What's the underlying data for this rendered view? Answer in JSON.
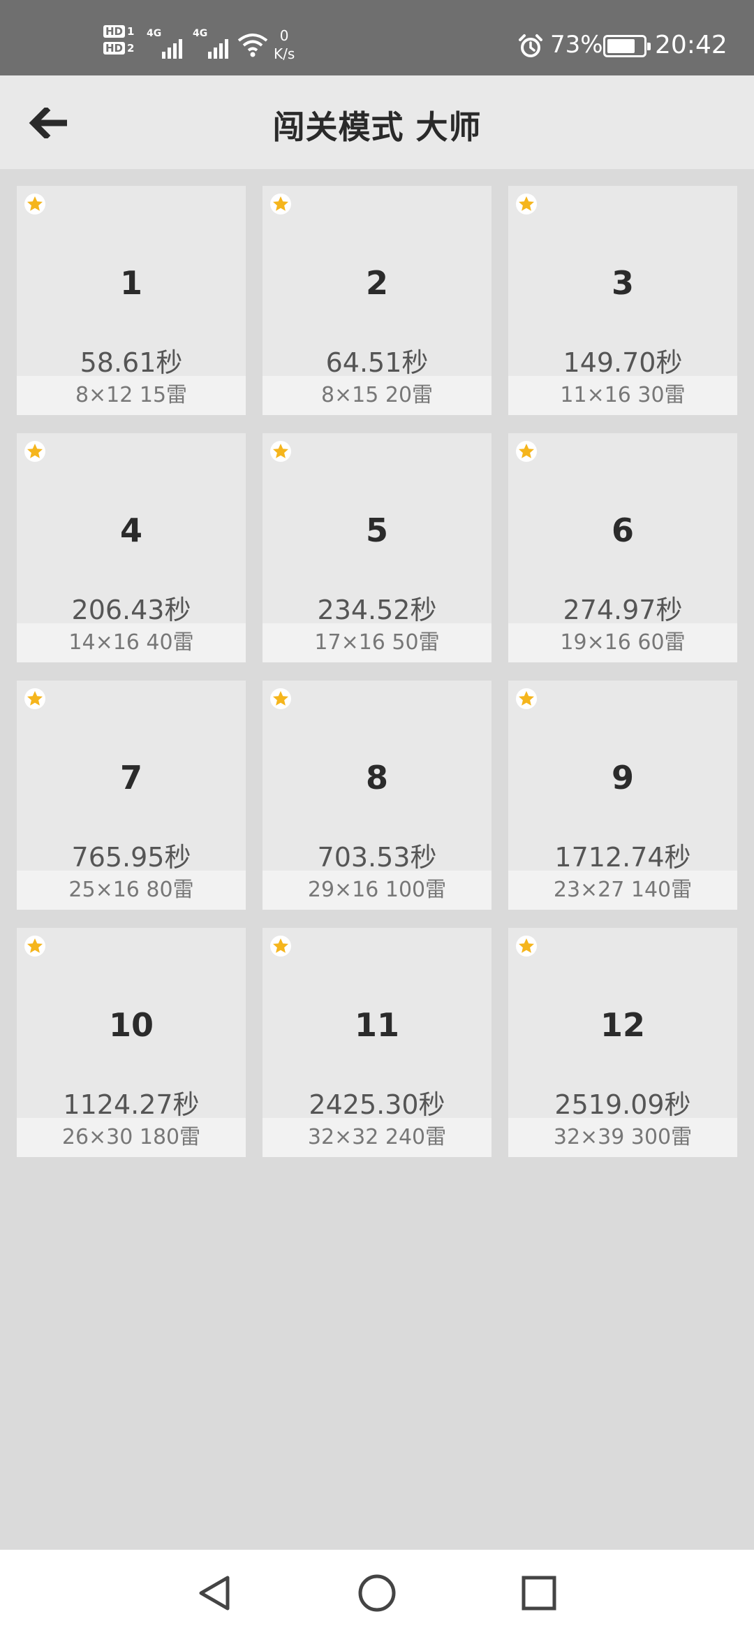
{
  "status_bar": {
    "hd1": "HD",
    "hd1_sim": "1",
    "hd2": "HD",
    "hd2_sim": "2",
    "net1": "4G",
    "net2": "4G",
    "speed_value": "0",
    "speed_unit": "K/s",
    "battery": "73%",
    "time": "20:42"
  },
  "header": {
    "title": "闯关模式 大师",
    "back_icon": "arrow-left-icon"
  },
  "levels": [
    {
      "number": "1",
      "time": "58.61秒",
      "info": "8×12  15雷"
    },
    {
      "number": "2",
      "time": "64.51秒",
      "info": "8×15  20雷"
    },
    {
      "number": "3",
      "time": "149.70秒",
      "info": "11×16  30雷"
    },
    {
      "number": "4",
      "time": "206.43秒",
      "info": "14×16  40雷"
    },
    {
      "number": "5",
      "time": "234.52秒",
      "info": "17×16  50雷"
    },
    {
      "number": "6",
      "time": "274.97秒",
      "info": "19×16  60雷"
    },
    {
      "number": "7",
      "time": "765.95秒",
      "info": "25×16  80雷"
    },
    {
      "number": "8",
      "time": "703.53秒",
      "info": "29×16  100雷"
    },
    {
      "number": "9",
      "time": "1712.74秒",
      "info": "23×27  140雷"
    },
    {
      "number": "10",
      "time": "1124.27秒",
      "info": "26×30  180雷"
    },
    {
      "number": "11",
      "time": "2425.30秒",
      "info": "32×32  240雷"
    },
    {
      "number": "12",
      "time": "2519.09秒",
      "info": "32×39  300雷"
    }
  ],
  "colors": {
    "star": "#f5b51c",
    "background": "#dadada",
    "card": "#e8e8e8"
  },
  "nav": {
    "back_icon": "triangle-back-icon",
    "home_icon": "circle-home-icon",
    "recents_icon": "square-recents-icon"
  }
}
